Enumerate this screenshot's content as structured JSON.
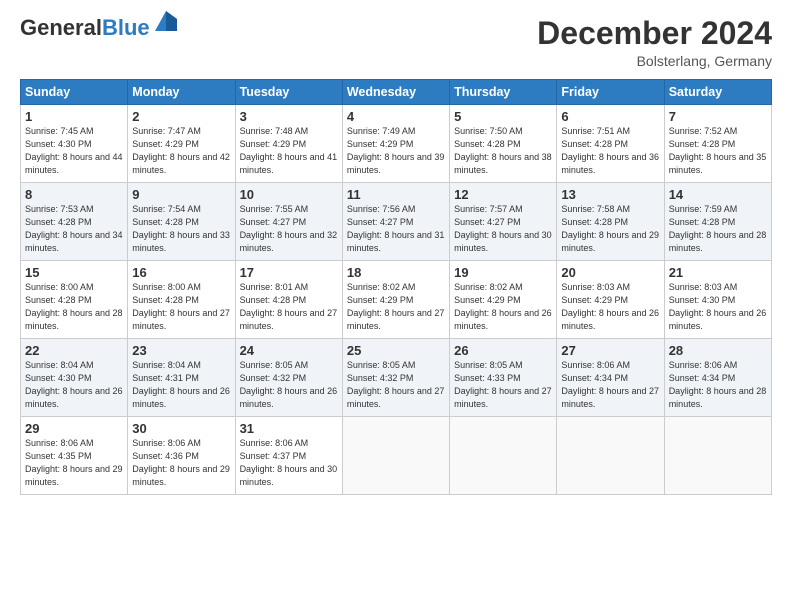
{
  "header": {
    "logo_line1": "General",
    "logo_line2": "Blue",
    "month": "December 2024",
    "location": "Bolsterlang, Germany"
  },
  "days_of_week": [
    "Sunday",
    "Monday",
    "Tuesday",
    "Wednesday",
    "Thursday",
    "Friday",
    "Saturday"
  ],
  "weeks": [
    [
      {
        "day": "1",
        "sunrise": "7:45 AM",
        "sunset": "4:30 PM",
        "daylight": "8 hours and 44 minutes."
      },
      {
        "day": "2",
        "sunrise": "7:47 AM",
        "sunset": "4:29 PM",
        "daylight": "8 hours and 42 minutes."
      },
      {
        "day": "3",
        "sunrise": "7:48 AM",
        "sunset": "4:29 PM",
        "daylight": "8 hours and 41 minutes."
      },
      {
        "day": "4",
        "sunrise": "7:49 AM",
        "sunset": "4:29 PM",
        "daylight": "8 hours and 39 minutes."
      },
      {
        "day": "5",
        "sunrise": "7:50 AM",
        "sunset": "4:28 PM",
        "daylight": "8 hours and 38 minutes."
      },
      {
        "day": "6",
        "sunrise": "7:51 AM",
        "sunset": "4:28 PM",
        "daylight": "8 hours and 36 minutes."
      },
      {
        "day": "7",
        "sunrise": "7:52 AM",
        "sunset": "4:28 PM",
        "daylight": "8 hours and 35 minutes."
      }
    ],
    [
      {
        "day": "8",
        "sunrise": "7:53 AM",
        "sunset": "4:28 PM",
        "daylight": "8 hours and 34 minutes."
      },
      {
        "day": "9",
        "sunrise": "7:54 AM",
        "sunset": "4:28 PM",
        "daylight": "8 hours and 33 minutes."
      },
      {
        "day": "10",
        "sunrise": "7:55 AM",
        "sunset": "4:27 PM",
        "daylight": "8 hours and 32 minutes."
      },
      {
        "day": "11",
        "sunrise": "7:56 AM",
        "sunset": "4:27 PM",
        "daylight": "8 hours and 31 minutes."
      },
      {
        "day": "12",
        "sunrise": "7:57 AM",
        "sunset": "4:27 PM",
        "daylight": "8 hours and 30 minutes."
      },
      {
        "day": "13",
        "sunrise": "7:58 AM",
        "sunset": "4:28 PM",
        "daylight": "8 hours and 29 minutes."
      },
      {
        "day": "14",
        "sunrise": "7:59 AM",
        "sunset": "4:28 PM",
        "daylight": "8 hours and 28 minutes."
      }
    ],
    [
      {
        "day": "15",
        "sunrise": "8:00 AM",
        "sunset": "4:28 PM",
        "daylight": "8 hours and 28 minutes."
      },
      {
        "day": "16",
        "sunrise": "8:00 AM",
        "sunset": "4:28 PM",
        "daylight": "8 hours and 27 minutes."
      },
      {
        "day": "17",
        "sunrise": "8:01 AM",
        "sunset": "4:28 PM",
        "daylight": "8 hours and 27 minutes."
      },
      {
        "day": "18",
        "sunrise": "8:02 AM",
        "sunset": "4:29 PM",
        "daylight": "8 hours and 27 minutes."
      },
      {
        "day": "19",
        "sunrise": "8:02 AM",
        "sunset": "4:29 PM",
        "daylight": "8 hours and 26 minutes."
      },
      {
        "day": "20",
        "sunrise": "8:03 AM",
        "sunset": "4:29 PM",
        "daylight": "8 hours and 26 minutes."
      },
      {
        "day": "21",
        "sunrise": "8:03 AM",
        "sunset": "4:30 PM",
        "daylight": "8 hours and 26 minutes."
      }
    ],
    [
      {
        "day": "22",
        "sunrise": "8:04 AM",
        "sunset": "4:30 PM",
        "daylight": "8 hours and 26 minutes."
      },
      {
        "day": "23",
        "sunrise": "8:04 AM",
        "sunset": "4:31 PM",
        "daylight": "8 hours and 26 minutes."
      },
      {
        "day": "24",
        "sunrise": "8:05 AM",
        "sunset": "4:32 PM",
        "daylight": "8 hours and 26 minutes."
      },
      {
        "day": "25",
        "sunrise": "8:05 AM",
        "sunset": "4:32 PM",
        "daylight": "8 hours and 27 minutes."
      },
      {
        "day": "26",
        "sunrise": "8:05 AM",
        "sunset": "4:33 PM",
        "daylight": "8 hours and 27 minutes."
      },
      {
        "day": "27",
        "sunrise": "8:06 AM",
        "sunset": "4:34 PM",
        "daylight": "8 hours and 27 minutes."
      },
      {
        "day": "28",
        "sunrise": "8:06 AM",
        "sunset": "4:34 PM",
        "daylight": "8 hours and 28 minutes."
      }
    ],
    [
      {
        "day": "29",
        "sunrise": "8:06 AM",
        "sunset": "4:35 PM",
        "daylight": "8 hours and 29 minutes."
      },
      {
        "day": "30",
        "sunrise": "8:06 AM",
        "sunset": "4:36 PM",
        "daylight": "8 hours and 29 minutes."
      },
      {
        "day": "31",
        "sunrise": "8:06 AM",
        "sunset": "4:37 PM",
        "daylight": "8 hours and 30 minutes."
      },
      null,
      null,
      null,
      null
    ]
  ]
}
